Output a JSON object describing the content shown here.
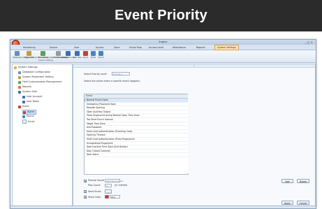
{
  "banner": {
    "title": "Event Priority"
  },
  "window": {
    "app_title": "Engine",
    "controls": "_ □ ×",
    "tabs": [
      {
        "label": "Monitoring"
      },
      {
        "label": "Device"
      },
      {
        "label": "User"
      },
      {
        "label": "Access"
      },
      {
        "label": "Zone"
      },
      {
        "label": "Visual Map"
      },
      {
        "label": "Access Level"
      },
      {
        "label": "Attendance"
      },
      {
        "label": "Reports"
      },
      {
        "label": "System Settings"
      }
    ],
    "active_tab": "System Settings"
  },
  "ribbon": {
    "buttons": [
      {
        "label": "Database Configuration",
        "color": "#6a8cc0"
      },
      {
        "label": "System Parameter Setting",
        "color": "#c79a3a"
      },
      {
        "label": "Field Customization Management",
        "color": "#5aa05a"
      },
      {
        "label": "Export Settings",
        "color": "#9a9a9a"
      },
      {
        "label": "User Account",
        "color": "#3d6db3"
      },
      {
        "label": "User Role",
        "color": "#3d6db3"
      },
      {
        "label": "Alarm",
        "color": "#c84030"
      },
      {
        "label": "Email",
        "color": "#4a82c8"
      },
      {
        "label": "Sound",
        "color": "#4a82c8"
      }
    ],
    "group_label": "System Settings"
  },
  "sidebar": {
    "items": [
      {
        "label": "System Settings",
        "level": 0,
        "icon": "folder-icon"
      },
      {
        "label": "Database Configuration",
        "level": 1,
        "icon": "database-icon"
      },
      {
        "label": "System Parameter Setting",
        "level": 1,
        "icon": "gear-icon"
      },
      {
        "label": "Field Customization Management",
        "level": 1,
        "icon": "field-icon"
      },
      {
        "label": "Reports",
        "level": 1,
        "icon": "report-icon"
      },
      {
        "label": "System User",
        "level": 1,
        "icon": "users-icon"
      },
      {
        "label": "User Account",
        "level": 2,
        "icon": "user-icon"
      },
      {
        "label": "User Roles",
        "level": 2,
        "icon": "role-icon"
      },
      {
        "label": "Event",
        "level": 1,
        "icon": "event-icon"
      },
      {
        "label": "Alarm",
        "level": 2,
        "icon": "alarm-icon",
        "selected": true
      },
      {
        "label": "Sound",
        "level": 2,
        "icon": "sound-icon"
      },
      {
        "label": "Email",
        "level": 2,
        "icon": "email-icon"
      }
    ]
  },
  "main": {
    "priority_label": "Select Priority Level",
    "priority_value": "Priority 1",
    "instruction": "Select the action when a specific event happens.",
    "grid_header": "Event",
    "events": [
      "Normal Punch Open",
      "Emergency Password Open",
      "Remote Opening",
      "Open Auxiliary Output",
      "Press Fingerprint during Normal Open Time Zone",
      "Too Short Punch Interval",
      "Illegal Time Zone",
      "Anti-Passback",
      "Multi-Card Authentication (Punching Card)",
      "Opening Timeout",
      "Multi-Card Authentication (Press Fingerprint)",
      "Unregistered Fingerprint",
      "Door Inactive Time Zone (Exit Button)",
      "Door Closed Correctly",
      "Door Alarm"
    ],
    "selected_event": 0,
    "bottom": {
      "prompt_sound_label": "Prompt Sound",
      "prompt_sound_value": "alarmsound.wav",
      "play_count_label": "Play Count",
      "play_count_value": "0",
      "play_count_note": "(0: Infinite)",
      "send_email_label": "Send Email",
      "show_color_label": "Show Color",
      "color_value": "Red",
      "color_hex": "#e02020",
      "add_label": "Add",
      "delete_label": "Delete",
      "apply_label": "Apply",
      "cancel_label": "Cancel"
    }
  }
}
